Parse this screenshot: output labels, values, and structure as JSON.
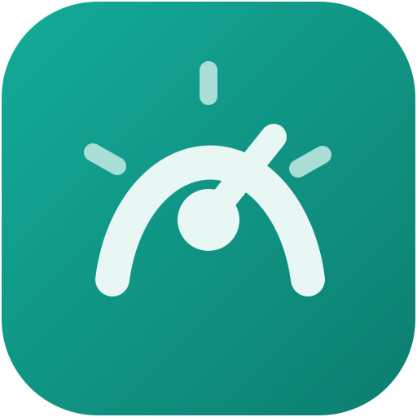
{
  "app_icon": {
    "icon_name": "speedometer-gauge-icon",
    "colors": {
      "background_start": "#14AB98",
      "background_end": "#0C7E70",
      "glyph": "#E8F6F4",
      "tick_marks": "#A9DED6"
    }
  }
}
